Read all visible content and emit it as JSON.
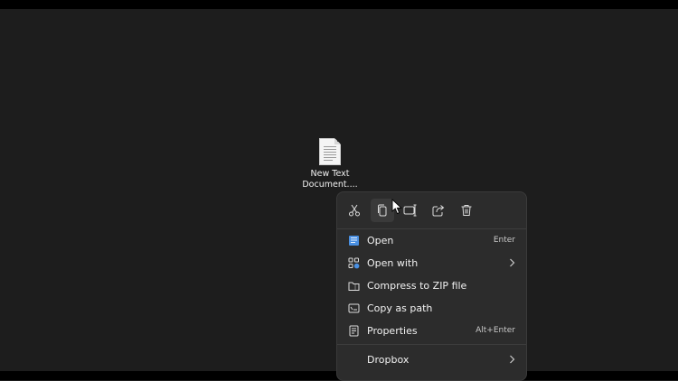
{
  "desktop": {
    "file": {
      "name_line1": "New Text",
      "name_line2": "Document...."
    }
  },
  "context_menu": {
    "toolbar": [
      "cut-icon",
      "copy-icon",
      "rename-icon",
      "share-icon",
      "delete-icon"
    ],
    "items": [
      {
        "label": "Open",
        "shortcut": "Enter",
        "icon": "notepad-icon"
      },
      {
        "label": "Open with",
        "shortcut": "",
        "icon": "open-with-icon",
        "submenu": true
      },
      {
        "label": "Compress to ZIP file",
        "shortcut": "",
        "icon": "zip-folder-icon"
      },
      {
        "label": "Copy as path",
        "shortcut": "",
        "icon": "copy-path-icon"
      },
      {
        "label": "Properties",
        "shortcut": "Alt+Enter",
        "icon": "properties-icon"
      },
      {
        "label": "Dropbox",
        "shortcut": "",
        "icon": "",
        "submenu": true
      }
    ]
  },
  "colors": {
    "menu_bg": "#2c2c2c",
    "desktop_bg": "#1d1d1d",
    "accent": "#4a90e2"
  }
}
